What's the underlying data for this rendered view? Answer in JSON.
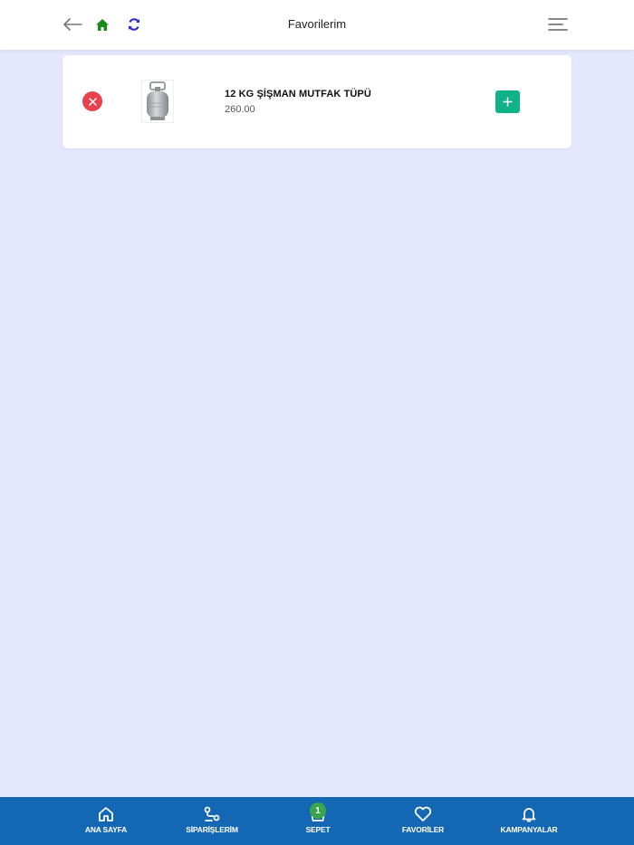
{
  "header": {
    "title": "Favorilerim",
    "icons": {
      "back": "arrow-left-icon",
      "home": "home-icon",
      "refresh": "refresh-icon",
      "menu": "menu-icon"
    }
  },
  "favorites": {
    "items": [
      {
        "name": "12 KG ŞİŞMAN MUTFAK TÜPÜ",
        "price": "260.00",
        "image_icon": "gas-cylinder-icon"
      }
    ]
  },
  "bottom_nav": {
    "items": [
      {
        "label": "ANA SAYFA",
        "icon": "home-icon"
      },
      {
        "label": "SİPARİŞLERİM",
        "icon": "route-icon"
      },
      {
        "label": "SEPET",
        "icon": "basket-icon",
        "badge": "1"
      },
      {
        "label": "FAVORİLER",
        "icon": "heart-icon"
      },
      {
        "label": "KAMPANYALAR",
        "icon": "bell-icon"
      }
    ]
  },
  "colors": {
    "background": "#e4e7fd",
    "nav_background": "#1468b3",
    "remove": "#e8424f",
    "add": "#10b389",
    "badge": "#3aa64b",
    "home_icon": "#1a8a1a",
    "refresh_icon": "#2a2ad0"
  }
}
